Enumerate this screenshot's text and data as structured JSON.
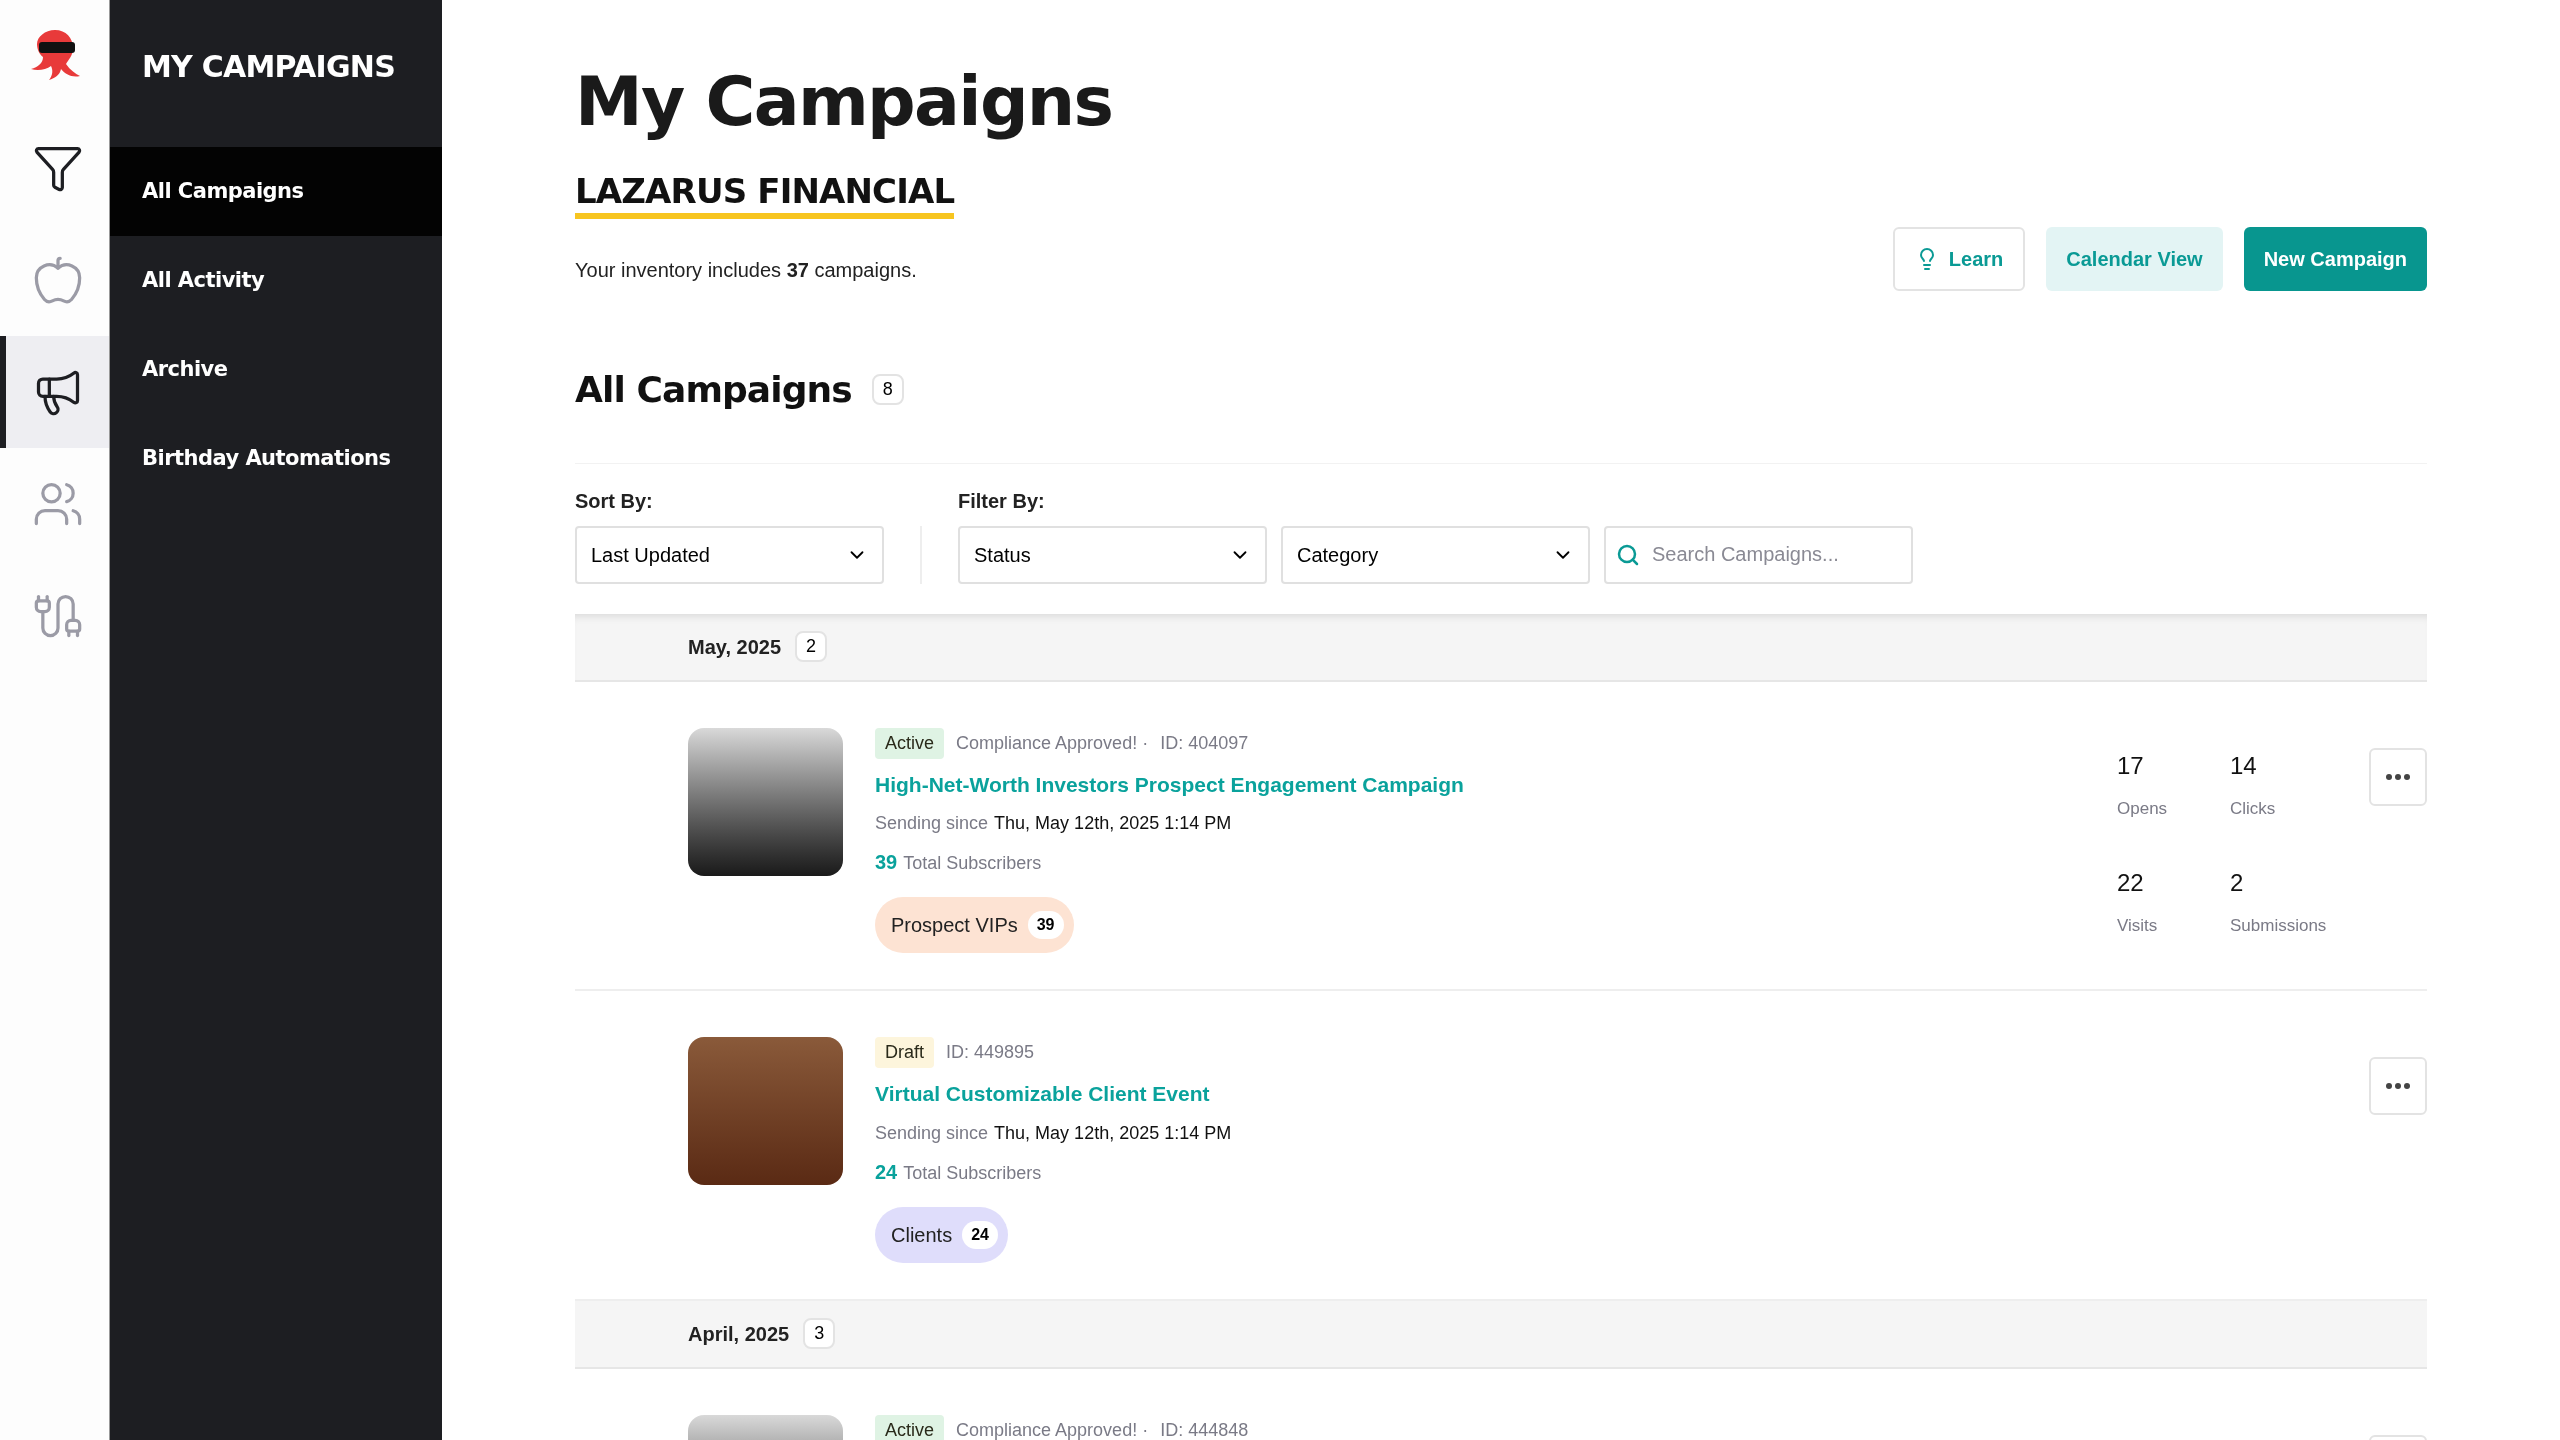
{
  "rail": {
    "items": [
      {
        "selected": false
      },
      {
        "selected": false
      },
      {
        "selected": true
      },
      {
        "selected": false
      },
      {
        "selected": false
      }
    ]
  },
  "sidebar": {
    "title": "MY CAMPAIGNS",
    "items": [
      {
        "label": "All Campaigns",
        "selected": true
      },
      {
        "label": "All Activity",
        "selected": false
      },
      {
        "label": "Archive",
        "selected": false
      },
      {
        "label": "Birthday Automations",
        "selected": false
      }
    ]
  },
  "header": {
    "title": "My Campaigns",
    "org": "LAZARUS FINANCIAL",
    "inventory": "Your inventory includes **37** campaigns.",
    "buttons": [
      {
        "label": "Learn",
        "kind": "outline"
      },
      {
        "label": "Calendar View",
        "kind": "soft"
      },
      {
        "label": "New Campaign",
        "kind": "primary"
      }
    ]
  },
  "section": {
    "title": "All Campaigns",
    "count": "8"
  },
  "filters": {
    "sort_label": "Sort By:",
    "sort_value": "Last Updated",
    "filter_label": "Filter By:",
    "selects": [
      "Status",
      "Category"
    ],
    "search_placeholder": "Search Campaigns..."
  },
  "groups": [
    {
      "month": "May, 2025",
      "count": "2",
      "campaigns": [
        {
          "status": {
            "label": "Active",
            "color": "#dff3e4"
          },
          "compliance": "Compliance Approved! ·",
          "id": "ID: 404097",
          "title": "High-Net-Worth Investors Prospect Engagement Campaign",
          "sending_label": "Sending since",
          "sending_date": "Thu, May 12th, 2025 1:14 PM",
          "subscribers": "39",
          "subscribers_label": "Total Subscribers",
          "list": {
            "name": "Prospect VIPs",
            "count": "39",
            "color": "#fde3d3"
          },
          "stats": [
            {
              "value": "17",
              "label": "Opens"
            },
            {
              "value": "14",
              "label": "Clicks"
            },
            {
              "value": "22",
              "label": "Visits"
            },
            {
              "value": "2",
              "label": "Submissions"
            }
          ]
        },
        {
          "status": {
            "label": "Draft",
            "color": "#fdf5dc"
          },
          "id": "ID: 449895",
          "title": "Virtual Customizable Client Event",
          "sending_label": "Sending since",
          "sending_date": "Thu, May 12th, 2025 1:14 PM",
          "subscribers": "24",
          "subscribers_label": "Total Subscribers",
          "list": {
            "name": "Clients",
            "count": "24",
            "color": "#dfddfb"
          }
        }
      ]
    },
    {
      "month": "April, 2025",
      "count": "3",
      "campaigns": [
        {
          "status": {
            "label": "Active",
            "color": "#dff3e4"
          },
          "compliance": "Compliance Approved! ·",
          "id": "ID: 444848"
        }
      ]
    }
  ]
}
